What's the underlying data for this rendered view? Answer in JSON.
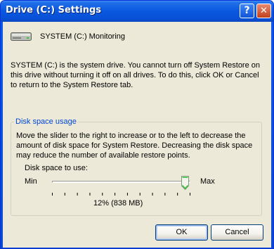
{
  "window": {
    "title": "Drive (C:) Settings",
    "help_label": "?",
    "close_label": "✕"
  },
  "drive": {
    "label": "SYSTEM (C:)  Monitoring",
    "icon": "hard-drive-icon"
  },
  "description": "SYSTEM (C:) is the system drive. You cannot turn off System Restore on this drive without turning it off on all drives. To do this, click OK or Cancel to return to the System Restore tab.",
  "disk_usage": {
    "group_title": "Disk space usage",
    "text": "Move the slider to the right to increase or to the left to decrease the amount of disk space for System Restore. Decreasing the disk space may reduce the number of available restore points.",
    "slider_label": "Disk space to use:",
    "min_label": "Min",
    "max_label": "Max",
    "value_fraction": 0.96,
    "tick_count": 12,
    "value_text": "12% (838 MB)"
  },
  "buttons": {
    "ok": "OK",
    "cancel": "Cancel"
  },
  "colors": {
    "title_bar": "#0a58e0",
    "dialog_bg": "#ece9d8",
    "group_title": "#0046d5"
  }
}
